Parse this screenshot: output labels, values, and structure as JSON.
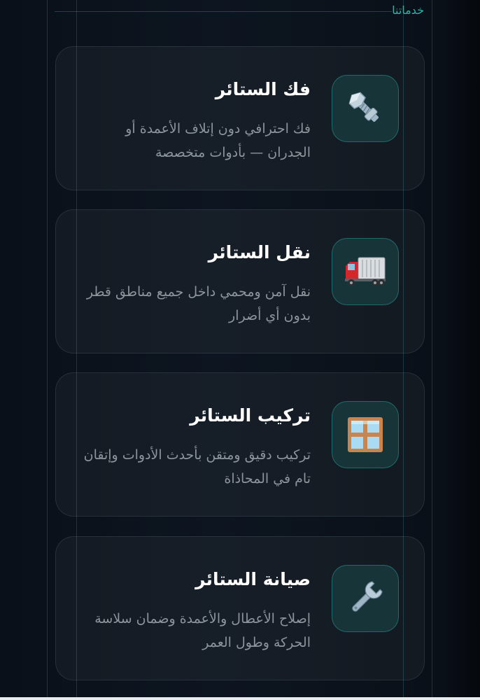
{
  "section": {
    "label": "خدماتنا"
  },
  "services": [
    {
      "icon": "bolt-icon",
      "title": "فك الستائر",
      "description": "فك احترافي دون إتلاف الأعمدة أو الجدران — بأدوات متخصصة"
    },
    {
      "icon": "truck-icon",
      "title": "نقل الستائر",
      "description": "نقل آمن ومحمي داخل جميع مناطق قطر بدون أي أضرار"
    },
    {
      "icon": "window-icon",
      "title": "تركيب الستائر",
      "description": "تركيب دقيق ومتقن بأحدث الأدوات وإتقان تام في المحاذاة"
    },
    {
      "icon": "wrench-icon",
      "title": "صيانة الستائر",
      "description": "إصلاح الأعطال والأعمدة وضمان سلاسة الحركة وطول العمر"
    }
  ],
  "colors": {
    "background": "#0b121c",
    "accent": "#2bb3a6",
    "icon_box": "#173438",
    "title": "#ffffff",
    "description": "#8c949c"
  }
}
